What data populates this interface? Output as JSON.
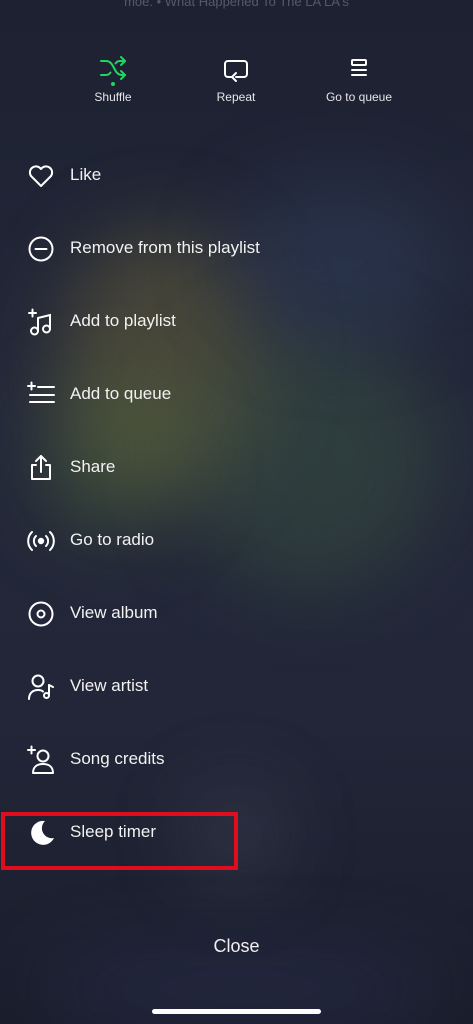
{
  "now_playing_faded": "moe. • What Happened To The LA LA's",
  "controls": {
    "shuffle": {
      "label": "Shuffle",
      "icon": "shuffle-icon",
      "active_color": "#1ed760"
    },
    "repeat": {
      "label": "Repeat",
      "icon": "repeat-icon"
    },
    "queue": {
      "label": "Go to queue",
      "icon": "queue-icon"
    }
  },
  "menu": {
    "items": [
      {
        "label": "Like",
        "icon": "heart-icon"
      },
      {
        "label": "Remove from this playlist",
        "icon": "minus-circle-icon"
      },
      {
        "label": "Add to playlist",
        "icon": "add-to-playlist-icon"
      },
      {
        "label": "Add to queue",
        "icon": "add-to-queue-icon"
      },
      {
        "label": "Share",
        "icon": "share-icon"
      },
      {
        "label": "Go to radio",
        "icon": "radio-icon"
      },
      {
        "label": "View album",
        "icon": "album-icon"
      },
      {
        "label": "View artist",
        "icon": "artist-icon"
      },
      {
        "label": "Song credits",
        "icon": "song-credits-icon"
      },
      {
        "label": "Sleep timer",
        "icon": "moon-icon"
      }
    ]
  },
  "highlight_color": "#e00d1c",
  "close_label": "Close"
}
